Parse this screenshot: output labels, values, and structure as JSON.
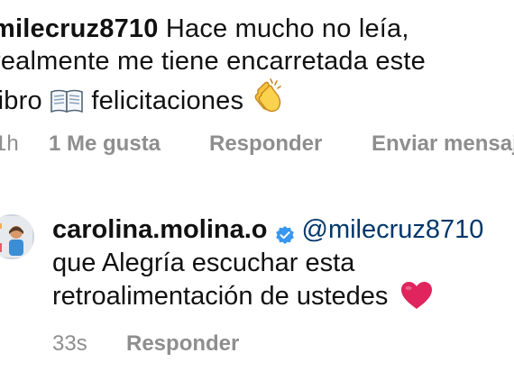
{
  "comment": {
    "username": "milecruz8710",
    "text_line1": "Hace mucho no leía,",
    "text_line2": "realmente me tiene encarretada este",
    "text_line3_start": "libro",
    "text_line3_end": "felicitaciones",
    "emoji_book": "book-icon",
    "emoji_clap": "clapping-hands-icon",
    "time": "1h",
    "likes": "1 Me gusta",
    "reply_label": "Responder",
    "send_label": "Enviar mensaje"
  },
  "reply": {
    "username": "carolina.molina.o",
    "verified_icon": "verified-badge-icon",
    "mention": "@milecruz8710",
    "text_line1": "que Alegría escuchar esta",
    "text_line2": "retroalimentación de ustedes",
    "emoji_heart": "red-heart-icon",
    "time": "33s",
    "reply_label": "Responder"
  },
  "colors": {
    "text": "#111111",
    "meta": "#8e8e8e",
    "mention": "#00376b",
    "verified": "#3897f0",
    "heart": "#e0245e"
  }
}
